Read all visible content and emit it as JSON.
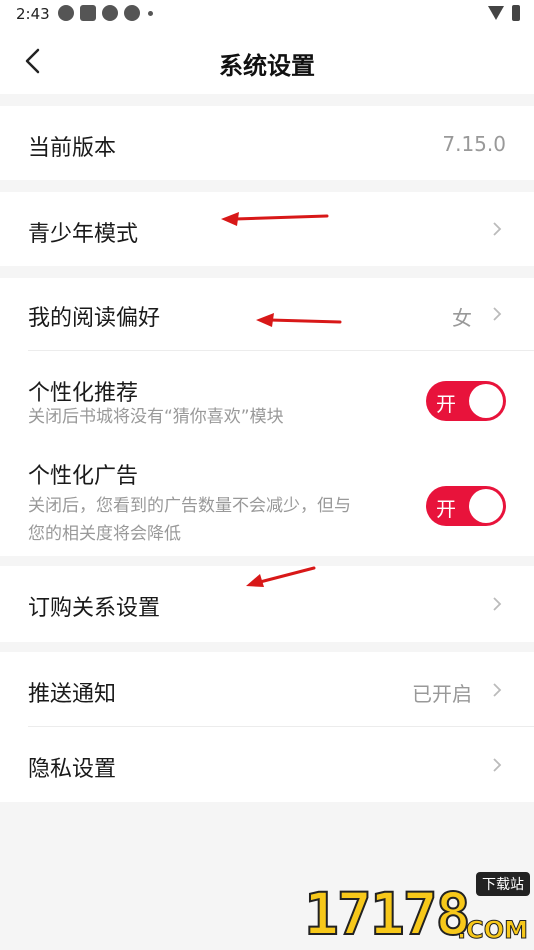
{
  "status_bar": {
    "time": "2:43",
    "left_icons": [
      "app-icon",
      "square-icon",
      "app-icon",
      "app-icon",
      "dot-icon"
    ],
    "right_icons": [
      "wifi-icon",
      "battery-icon"
    ]
  },
  "header": {
    "title": "系统设置",
    "back_icon": "back-chevron-icon"
  },
  "settings": {
    "version": {
      "label": "当前版本",
      "value": "7.15.0"
    },
    "teen_mode": {
      "label": "青少年模式"
    },
    "reading_pref": {
      "label": "我的阅读偏好",
      "value": "女"
    },
    "personalized_rec": {
      "label": "个性化推荐",
      "desc": "关闭后书城将没有“猜你喜欢”模块",
      "toggle": "开",
      "on": true
    },
    "personalized_ads": {
      "label": "个性化广告",
      "desc_line1": "关闭后，您看到的广告数量不会减少，但与",
      "desc_line2": "您的相关度将会降低",
      "toggle": "开",
      "on": true
    },
    "subscription": {
      "label": "订购关系设置"
    },
    "push": {
      "label": "推送通知",
      "value": "已开启"
    },
    "privacy": {
      "label": "隐私设置"
    }
  },
  "colors": {
    "accent": "#e8133b",
    "annotation_arrow": "#d81818",
    "background": "#f5f5f5"
  },
  "watermark": {
    "number": "17178",
    "tag": "下载站",
    "domain": ".COM"
  }
}
